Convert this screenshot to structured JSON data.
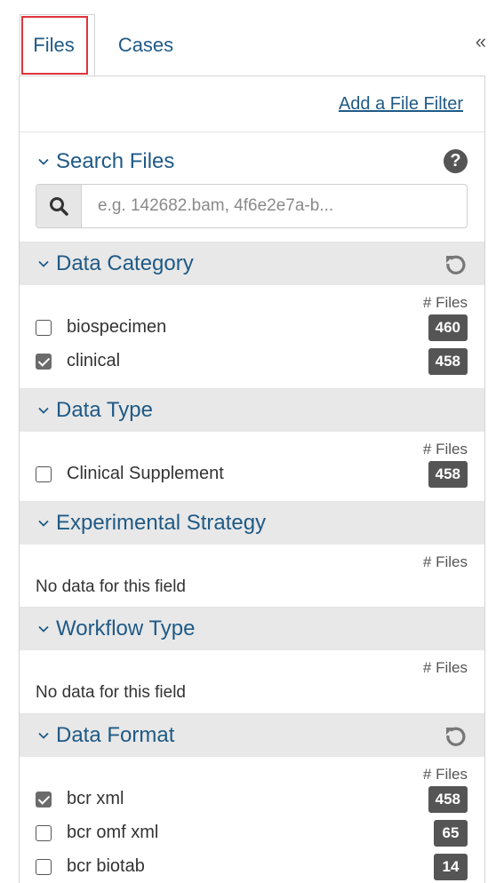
{
  "tabs": {
    "files": "Files",
    "cases": "Cases",
    "collapse": "«"
  },
  "add_filter": "Add a File Filter",
  "search": {
    "title": "Search Files",
    "placeholder": "e.g. 142682.bam, 4f6e2e7a-b..."
  },
  "files_header": "# Files",
  "no_data": "No data for this field",
  "facets": {
    "data_category": {
      "title": "Data Category",
      "items": [
        {
          "label": "biospecimen",
          "count": "460",
          "checked": false
        },
        {
          "label": "clinical",
          "count": "458",
          "checked": true
        }
      ]
    },
    "data_type": {
      "title": "Data Type",
      "items": [
        {
          "label": "Clinical Supplement",
          "count": "458",
          "checked": false
        }
      ]
    },
    "experimental_strategy": {
      "title": "Experimental Strategy"
    },
    "workflow_type": {
      "title": "Workflow Type"
    },
    "data_format": {
      "title": "Data Format",
      "items": [
        {
          "label": "bcr xml",
          "count": "458",
          "checked": true
        },
        {
          "label": "bcr omf xml",
          "count": "65",
          "checked": false
        },
        {
          "label": "bcr biotab",
          "count": "14",
          "checked": false
        }
      ]
    }
  },
  "colors": {
    "link": "#1f5a86",
    "badge": "#555555",
    "highlight": "#e0333c",
    "section_bg": "#e8e8e8"
  }
}
